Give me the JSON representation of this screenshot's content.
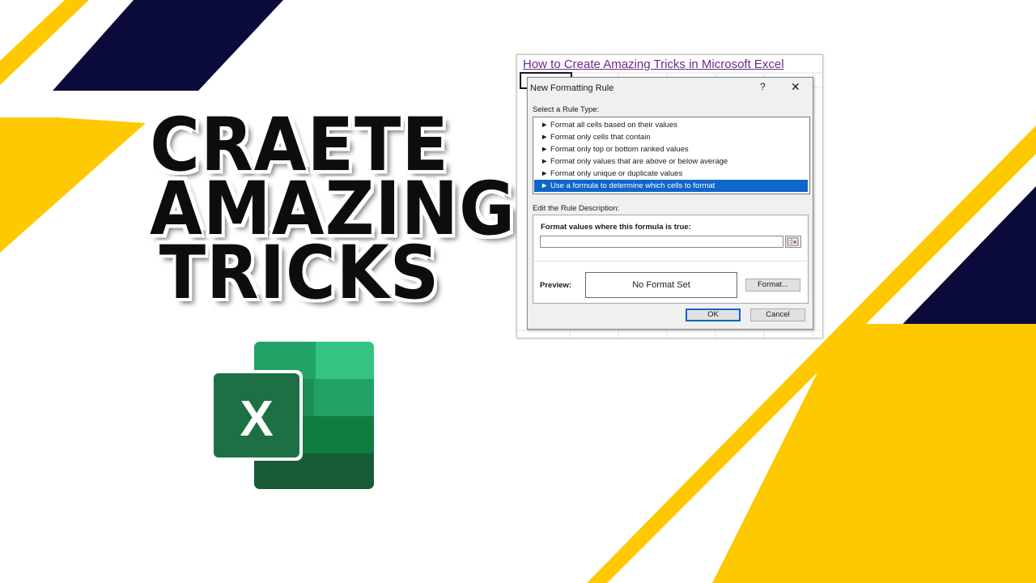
{
  "headline": {
    "line1": "CRAETE",
    "line2": "AMAZING",
    "line3": "TRICKS"
  },
  "logo": {
    "letter": "X",
    "icon": "excel-logo-icon"
  },
  "spreadsheet": {
    "link_text": "How to Create Amazing Tricks in Microsoft Excel"
  },
  "dialog": {
    "title": "New Formatting Rule",
    "help": "?",
    "close": "✕",
    "rule_type_label": "Select a Rule Type:",
    "rule_types": [
      {
        "label": "► Format all cells based on their values"
      },
      {
        "label": "► Format only cells that contain"
      },
      {
        "label": "► Format only top or bottom ranked values"
      },
      {
        "label": "► Format only values that are above or below average"
      },
      {
        "label": "► Format only unique or duplicate values"
      },
      {
        "label": "► Use a formula to determine which cells to format"
      }
    ],
    "selected_index": 5,
    "description_label": "Edit the Rule Description:",
    "formula_label": "Format values where this formula is true:",
    "formula_value": "",
    "preview_label": "Preview:",
    "preview_text": "No Format Set",
    "format_button": "Format...",
    "ok_button": "OK",
    "cancel_button": "Cancel"
  },
  "colors": {
    "yellow": "#fec900",
    "navy": "#0b0b3b",
    "excel_green": "#1d7044",
    "selection_blue": "#0f66c9"
  }
}
